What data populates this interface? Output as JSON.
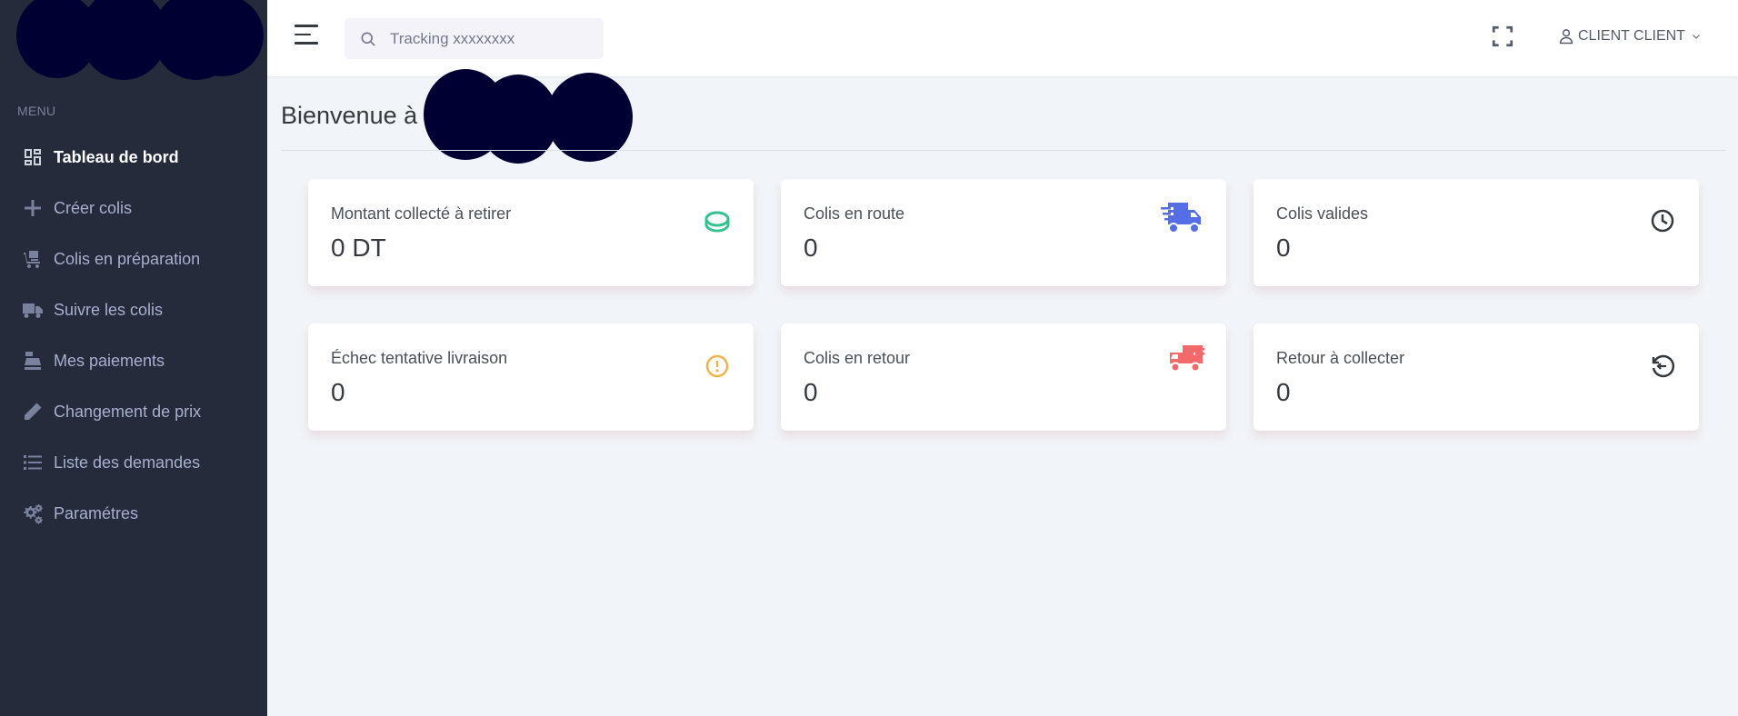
{
  "sidebar": {
    "menu_title": "MENU",
    "items": [
      {
        "label": "Tableau de bord",
        "icon": "dashboard-icon",
        "active": true
      },
      {
        "label": "Créer colis",
        "icon": "plus-icon"
      },
      {
        "label": "Colis en préparation",
        "icon": "dolly-icon"
      },
      {
        "label": "Suivre les colis",
        "icon": "truck-icon"
      },
      {
        "label": "Mes paiements",
        "icon": "cash-register-icon"
      },
      {
        "label": "Changement de prix",
        "icon": "pencil-icon"
      },
      {
        "label": "Liste des demandes",
        "icon": "list-icon"
      },
      {
        "label": "Paramétres",
        "icon": "gears-icon"
      }
    ]
  },
  "topbar": {
    "search_placeholder": "Tracking xxxxxxxx",
    "user_name": "CLIENT CLIENT"
  },
  "page": {
    "title": "Bienvenue à"
  },
  "cards": [
    {
      "label": "Montant collecté à retirer",
      "value": "0 DT",
      "icon": "coins-icon",
      "icon_color": "#34c38f"
    },
    {
      "label": "Colis en route",
      "value": "0",
      "icon": "shipping-fast-icon",
      "icon_color": "#556ee6"
    },
    {
      "label": "Colis valides",
      "value": "0",
      "icon": "clock-icon",
      "icon_color": "#343a40"
    },
    {
      "label": "Échec tentative livraison",
      "value": "0",
      "icon": "exclamation-icon",
      "icon_color": "#f1b44c"
    },
    {
      "label": "Colis en retour",
      "value": "0",
      "icon": "shipping-fast-icon",
      "icon_color": "#f46a6a"
    },
    {
      "label": "Retour à collecter",
      "value": "0",
      "icon": "return-icon",
      "icon_color": "#343a40"
    }
  ]
}
